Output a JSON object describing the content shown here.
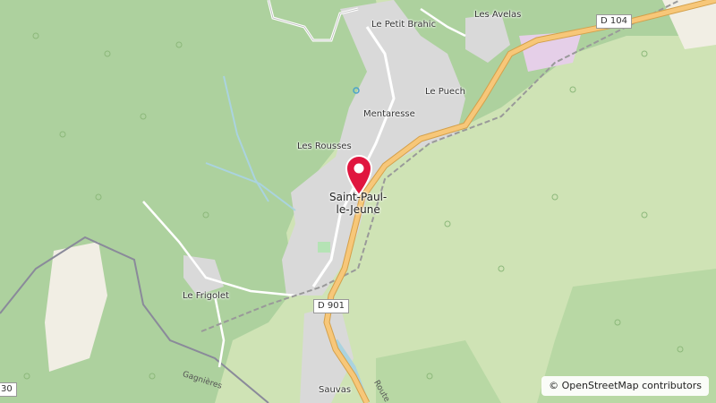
{
  "map": {
    "places": {
      "les_avelas": "Les Avelas",
      "le_petit_brahic": "Le Petit Brahic",
      "le_puech": "Le Puech",
      "mentaresse": "Mentaresse",
      "les_rousses": "Les Rousses",
      "le_frigolet": "Le Frigolet",
      "sauvas": "Sauvas"
    },
    "town": {
      "line1": "Saint-Paul-",
      "line2": "le-Jeune"
    },
    "roads": {
      "d104": "D 104",
      "d901": "D 901",
      "edge_30": "30",
      "gagnieres": "Gagnières",
      "route": "Route"
    },
    "attribution": "© OpenStreetMap contributors",
    "marker_icon": "map-pin-icon",
    "colors": {
      "forest": "#add19e",
      "meadow": "#cfe3b5",
      "urban": "#d9d9d9",
      "road_major": "#f7c779",
      "marker": "#e0163f",
      "water": "#aad3df"
    }
  }
}
